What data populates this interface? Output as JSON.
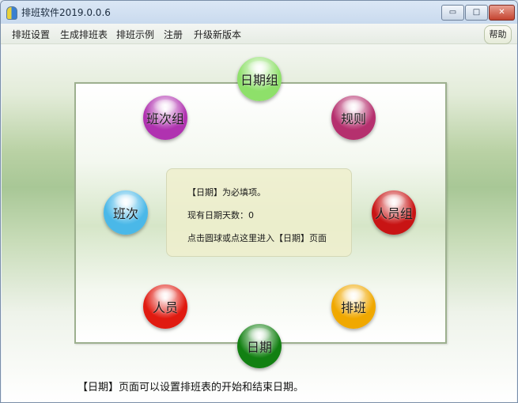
{
  "window": {
    "title": "排班软件2019.0.0.6",
    "controls": {
      "minimize": "▭",
      "maximize": "□",
      "close": "✕"
    }
  },
  "menubar": {
    "items": [
      "排班设置",
      "生成排班表",
      "排班示例",
      "注册",
      "升级新版本"
    ],
    "help": "帮助"
  },
  "info": {
    "line1": "【日期】为必填项。",
    "line2": "现有日期天数：0",
    "line3": "点击圆球或点这里进入【日期】页面"
  },
  "balls": {
    "date_group": {
      "label": "日期组",
      "color": "#8ee06a"
    },
    "shift_group": {
      "label": "班次组",
      "color": "#b032b0"
    },
    "rule": {
      "label": "规则",
      "color": "#b5306e"
    },
    "shift": {
      "label": "班次",
      "color": "#4ab8e8"
    },
    "staff_group": {
      "label": "人员组",
      "color": "#c81414"
    },
    "staff": {
      "label": "人员",
      "color": "#e01a10"
    },
    "schedule": {
      "label": "排班",
      "color": "#f0a800"
    },
    "date": {
      "label": "日期",
      "color": "#128012"
    }
  },
  "footer": {
    "text": "【日期】页面可以设置排班表的开始和结束日期。"
  }
}
